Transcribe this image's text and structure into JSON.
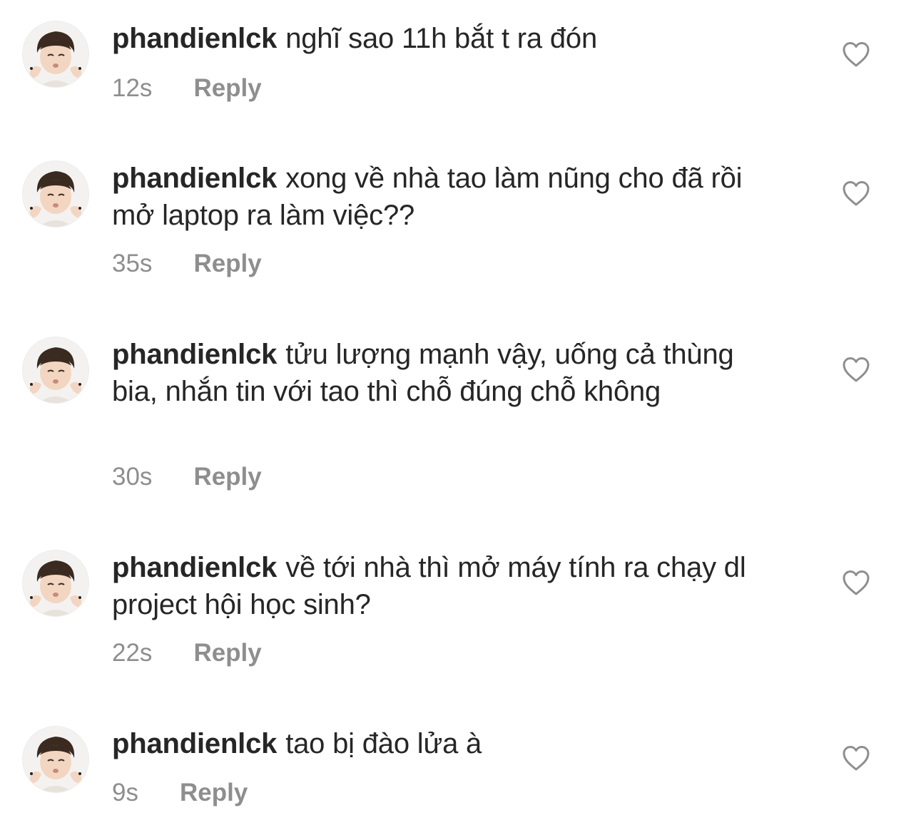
{
  "comments": [
    {
      "username": "phandienlck",
      "text": "nghĩ sao 11h bắt t ra đón",
      "time": "12s",
      "reply_label": "Reply",
      "avatar_icon": "user-avatar-icon",
      "like_icon": "heart-outline-icon"
    },
    {
      "username": "phandienlck",
      "text": "xong về nhà tao làm nũng cho đã rồi mở laptop ra làm việc??",
      "time": "35s",
      "reply_label": "Reply",
      "avatar_icon": "user-avatar-icon",
      "like_icon": "heart-outline-icon"
    },
    {
      "username": "phandienlck",
      "text": "tửu lượng mạnh vậy, uống cả thùng bia, nhắn tin với tao thì chỗ đúng chỗ không",
      "time": "30s",
      "reply_label": "Reply",
      "avatar_icon": "user-avatar-icon",
      "like_icon": "heart-outline-icon"
    },
    {
      "username": "phandienlck",
      "text": "về tới nhà thì mở máy tính ra chạy dl project hội học sinh?",
      "time": "22s",
      "reply_label": "Reply",
      "avatar_icon": "user-avatar-icon",
      "like_icon": "heart-outline-icon"
    },
    {
      "username": "phandienlck",
      "text": "tao bị đào lửa à",
      "time": "9s",
      "reply_label": "Reply",
      "avatar_icon": "user-avatar-icon",
      "like_icon": "heart-outline-icon"
    }
  ],
  "colors": {
    "username": "#262626",
    "body_text": "#262626",
    "meta_text": "#8e8e8e",
    "heart_stroke": "#8e8e8e",
    "background": "#ffffff"
  }
}
